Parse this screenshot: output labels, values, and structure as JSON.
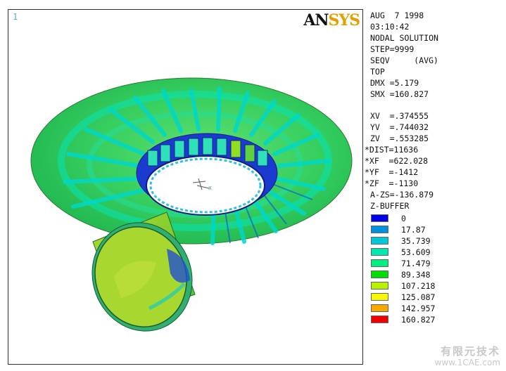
{
  "viewport": {
    "window_number": "1",
    "logo_part1": "AN",
    "logo_part2": "SYS"
  },
  "info": {
    "date": "AUG  7 1998",
    "time": "03:10:42",
    "solution": "NODAL SOLUTION",
    "step": "STEP=9999",
    "seqv": "SEQV     (AVG)",
    "view": "TOP",
    "dmx": "DMX =5.179",
    "smx": "SMX =160.827",
    "xv": "XV  =.374555",
    "yv": "YV  =.744032",
    "zv": "ZV  =.553285",
    "dist": "*DIST=11636",
    "xf": "*XF  =622.028",
    "yf": "*YF  =-1412",
    "zf": "*ZF  =-1130",
    "azs": "A-ZS=-136.879",
    "zbuffer": "Z-BUFFER"
  },
  "legend": [
    {
      "label": "0",
      "color": "#0000e8"
    },
    {
      "label": "17.87",
      "color": "#0090e0"
    },
    {
      "label": "35.739",
      "color": "#00c8d8"
    },
    {
      "label": "53.609",
      "color": "#00e8b0"
    },
    {
      "label": "71.479",
      "color": "#00f080"
    },
    {
      "label": "89.348",
      "color": "#00e000"
    },
    {
      "label": "107.218",
      "color": "#b8f000"
    },
    {
      "label": "125.087",
      "color": "#f8f800"
    },
    {
      "label": "142.957",
      "color": "#f8a800"
    },
    {
      "label": "160.827",
      "color": "#f00000"
    }
  ],
  "watermark": {
    "line1": "有限元技术",
    "line2": "www.1CAE.com"
  },
  "axis": {
    "x": "X",
    "y": "Y"
  }
}
